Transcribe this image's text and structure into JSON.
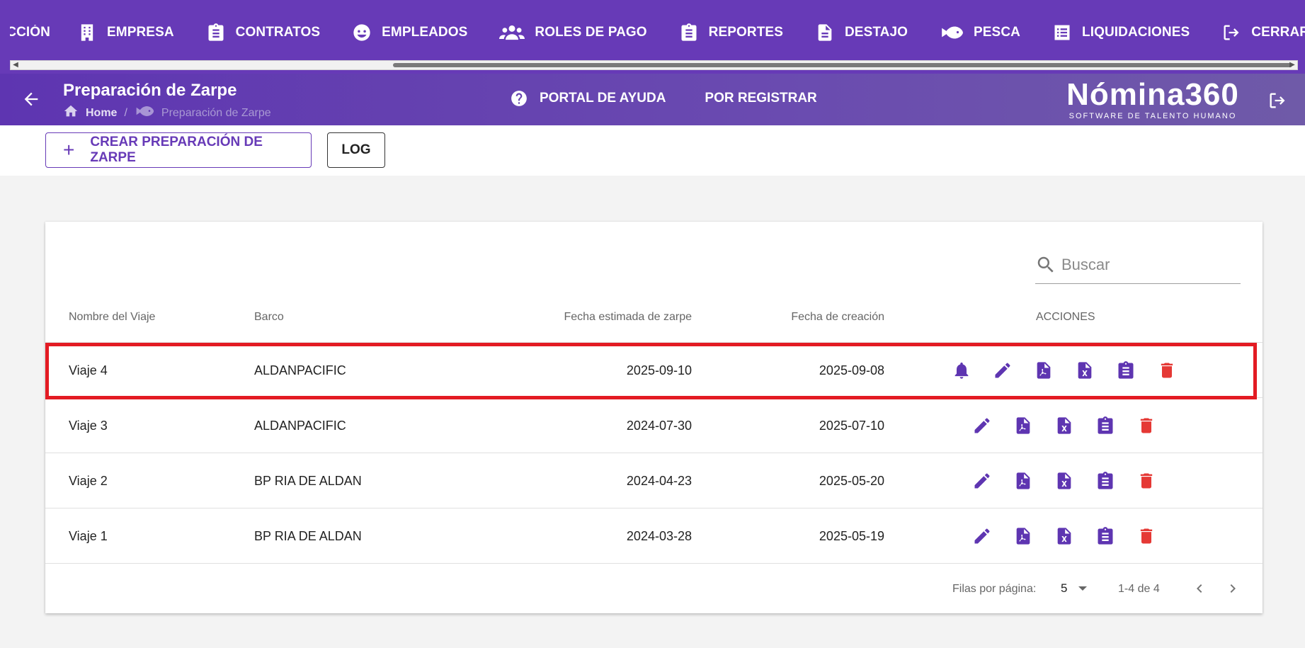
{
  "topnav": {
    "items": [
      {
        "label": "ACCIÓN",
        "icon": "none"
      },
      {
        "label": "EMPRESA",
        "icon": "building-icon"
      },
      {
        "label": "CONTRATOS",
        "icon": "clipboard-icon"
      },
      {
        "label": "EMPLEADOS",
        "icon": "face-icon"
      },
      {
        "label": "ROLES DE PAGO",
        "icon": "people-icon"
      },
      {
        "label": "REPORTES",
        "icon": "clipboard-list-icon"
      },
      {
        "label": "DESTAJO",
        "icon": "document-icon"
      },
      {
        "label": "PESCA",
        "icon": "fish-icon"
      },
      {
        "label": "LIQUIDACIONES",
        "icon": "list-icon"
      },
      {
        "label": "CERRAR SESIÓN",
        "icon": "logout-icon"
      }
    ]
  },
  "header": {
    "title": "Preparación de Zarpe",
    "breadcrumb": {
      "home": "Home",
      "current": "Preparación de Zarpe"
    },
    "links": {
      "help": "PORTAL DE AYUDA",
      "pending": "POR REGISTRAR"
    },
    "brand": {
      "name": "Nómina360",
      "tagline": "SOFTWARE DE TALENTO HUMANO"
    }
  },
  "toolbar": {
    "create_label": "CREAR PREPARACIÓN DE ZARPE",
    "log_label": "LOG"
  },
  "search": {
    "placeholder": "Buscar"
  },
  "table": {
    "headers": {
      "name": "Nombre del Viaje",
      "boat": "Barco",
      "est_date": "Fecha estimada de zarpe",
      "created": "Fecha de creación",
      "actions": "ACCIONES"
    },
    "rows": [
      {
        "name": "Viaje 4",
        "boat": "ALDANPACIFIC",
        "est_date": "2025-09-10",
        "created": "2025-09-08",
        "has_notify": true,
        "highlighted": true
      },
      {
        "name": "Viaje 3",
        "boat": "ALDANPACIFIC",
        "est_date": "2024-07-30",
        "created": "2025-07-10",
        "has_notify": false,
        "highlighted": false
      },
      {
        "name": "Viaje 2",
        "boat": "BP RIA DE ALDAN",
        "est_date": "2024-04-23",
        "created": "2025-05-20",
        "has_notify": false,
        "highlighted": false
      },
      {
        "name": "Viaje 1",
        "boat": "BP RIA DE ALDAN",
        "est_date": "2024-03-28",
        "created": "2025-05-19",
        "has_notify": false,
        "highlighted": false
      }
    ]
  },
  "pagination": {
    "rows_per_page_label": "Filas por página:",
    "rows_per_page": "5",
    "range": "1-4 de 4"
  },
  "colors": {
    "primary": "#673ab7",
    "danger": "#e53935",
    "highlight": "#e31b23"
  }
}
